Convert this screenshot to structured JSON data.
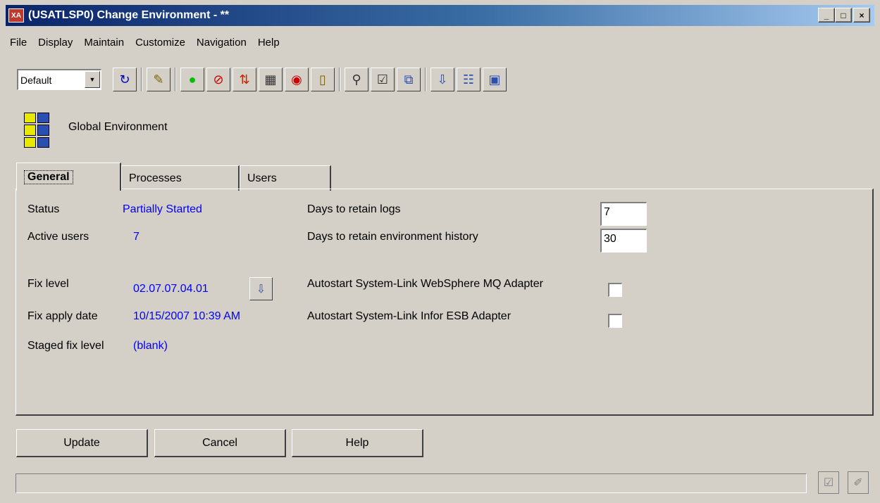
{
  "window": {
    "app_icon_text": "XA",
    "title": "(USATLSP0) Change Environment - **",
    "minimize": "_",
    "maximize": "□",
    "close": "×"
  },
  "menu": [
    "File",
    "Display",
    "Maintain",
    "Customize",
    "Navigation",
    "Help"
  ],
  "toolbar": {
    "view_select": "Default",
    "icons": [
      {
        "name": "refresh-icon",
        "glyph": "↻",
        "color": "#0000cc"
      },
      {
        "name": "pencil-icon",
        "glyph": "✎",
        "color": "#806000"
      },
      {
        "name": "start-icon",
        "glyph": "●",
        "color": "#00c000"
      },
      {
        "name": "stop-icon",
        "glyph": "⊘",
        "color": "#cc0000"
      },
      {
        "name": "transfer-icon",
        "glyph": "⇅",
        "color": "#cc2200"
      },
      {
        "name": "server-icon",
        "glyph": "▦",
        "color": "#333333"
      },
      {
        "name": "lock-icon",
        "glyph": "◉",
        "color": "#cc0000"
      },
      {
        "name": "info-icon",
        "glyph": "▯",
        "color": "#806000"
      },
      {
        "name": "network-icon",
        "glyph": "⚲",
        "color": "#333333"
      },
      {
        "name": "checklist-icon",
        "glyph": "☑",
        "color": "#333333"
      },
      {
        "name": "windows-icon",
        "glyph": "⧉",
        "color": "#2a4fb0"
      },
      {
        "name": "fix-install-icon",
        "glyph": "⇩",
        "color": "#2a4fb0"
      },
      {
        "name": "fix-list-icon",
        "glyph": "☷",
        "color": "#2a4fb0"
      },
      {
        "name": "environment-icon",
        "glyph": "▣",
        "color": "#2a4fb0"
      }
    ]
  },
  "header": {
    "title": "Global Environment"
  },
  "tabs": [
    "General",
    "Processes",
    "Users"
  ],
  "general": {
    "status_label": "Status",
    "status_value": "Partially Started",
    "active_users_label": "Active users",
    "active_users_value": "7",
    "fix_level_label": "Fix level",
    "fix_level_value": "02.07.07.04.01",
    "fix_apply_date_label": "Fix apply date",
    "fix_apply_date_value": "10/15/2007 10:39 AM",
    "staged_fix_label": "Staged fix level",
    "staged_fix_value": "(blank)",
    "retain_logs_label": "Days to retain logs",
    "retain_logs_value": "7",
    "retain_history_label": "Days to retain environment history",
    "retain_history_value": "30",
    "autostart_mq_label": "Autostart System-Link WebSphere MQ Adapter",
    "autostart_mq_checked": false,
    "autostart_esb_label": "Autostart System-Link Infor ESB Adapter",
    "autostart_esb_checked": false
  },
  "buttons": {
    "update": "Update",
    "cancel": "Cancel",
    "help": "Help"
  },
  "status_bar": {
    "text": ""
  }
}
